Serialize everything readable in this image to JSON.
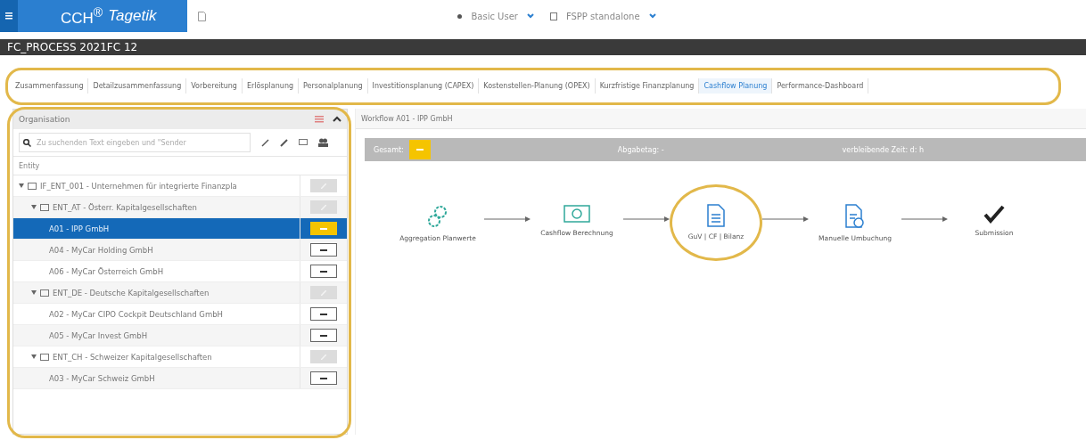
{
  "header": {
    "brand": "CCH$^{®}$",
    "product": "Tagetik",
    "user": "Basic User",
    "environment": "FSPP standalone"
  },
  "process_title": "FC_PROCESS 2021FC 12",
  "tabs": [
    {
      "label": "Zusammenfassung",
      "selected": false
    },
    {
      "label": "Detailzusammenfassung",
      "selected": false
    },
    {
      "label": "Vorbereitung",
      "selected": false
    },
    {
      "label": "Erlösplanung",
      "selected": false
    },
    {
      "label": "Personalplanung",
      "selected": false
    },
    {
      "label": "Investitionsplanung (CAPEX)",
      "selected": false
    },
    {
      "label": "Kostenstellen-Planung (OPEX)",
      "selected": false
    },
    {
      "label": "Kurzfristige Finanzplanung",
      "selected": false
    },
    {
      "label": "Cashflow Planung",
      "selected": true
    },
    {
      "label": "Performance-Dashboard",
      "selected": false
    }
  ],
  "organisation": {
    "title": "Organisation",
    "search_placeholder": "Zu suchenden Text eingeben und \"Sender",
    "column": "Entity",
    "tree": [
      {
        "label": "IF_ENT_001 - Unternehmen für integrierte Finanzpla",
        "kind": "locked",
        "selected": false,
        "expanded": true,
        "children": [
          {
            "label": "ENT_AT - Österr. Kapitalgesellschaften",
            "kind": "locked",
            "selected": false,
            "expanded": true,
            "children": [
              {
                "label": "A01 - IPP GmbH",
                "kind": "pending",
                "selected": true
              },
              {
                "label": "A04 - MyCar Holding GmbH",
                "kind": "open",
                "selected": false
              },
              {
                "label": "A06 - MyCar Österreich GmbH",
                "kind": "open",
                "selected": false
              }
            ]
          },
          {
            "label": "ENT_DE - Deutsche Kapitalgesellschaften",
            "kind": "locked",
            "selected": false,
            "expanded": true,
            "children": [
              {
                "label": "A02 - MyCar CIPO Cockpit Deutschland GmbH",
                "kind": "open",
                "selected": false
              },
              {
                "label": "A05 - MyCar Invest GmbH",
                "kind": "open",
                "selected": false
              }
            ]
          },
          {
            "label": "ENT_CH - Schweizer Kapitalgesellschaften",
            "kind": "locked",
            "selected": false,
            "expanded": true,
            "children": [
              {
                "label": "A03 - MyCar Schweiz GmbH",
                "kind": "open",
                "selected": false
              }
            ]
          }
        ]
      }
    ]
  },
  "workflow": {
    "title": "Workflow A01 - IPP GmbH",
    "total_label": "Gesamt:",
    "due_label": "Abgabetag: -",
    "remaining_label": "verbleibende Zeit: d: h",
    "steps": [
      {
        "kind": "gears",
        "label": "Aggregation Planwerte"
      },
      {
        "kind": "cash",
        "label": "Cashflow Berechnung"
      },
      {
        "kind": "document",
        "label": "GuV | CF | Bilanz",
        "highlighted": true
      },
      {
        "kind": "edit",
        "label": "Manuelle Umbuchung"
      },
      {
        "kind": "check",
        "label": "Submission"
      }
    ]
  }
}
